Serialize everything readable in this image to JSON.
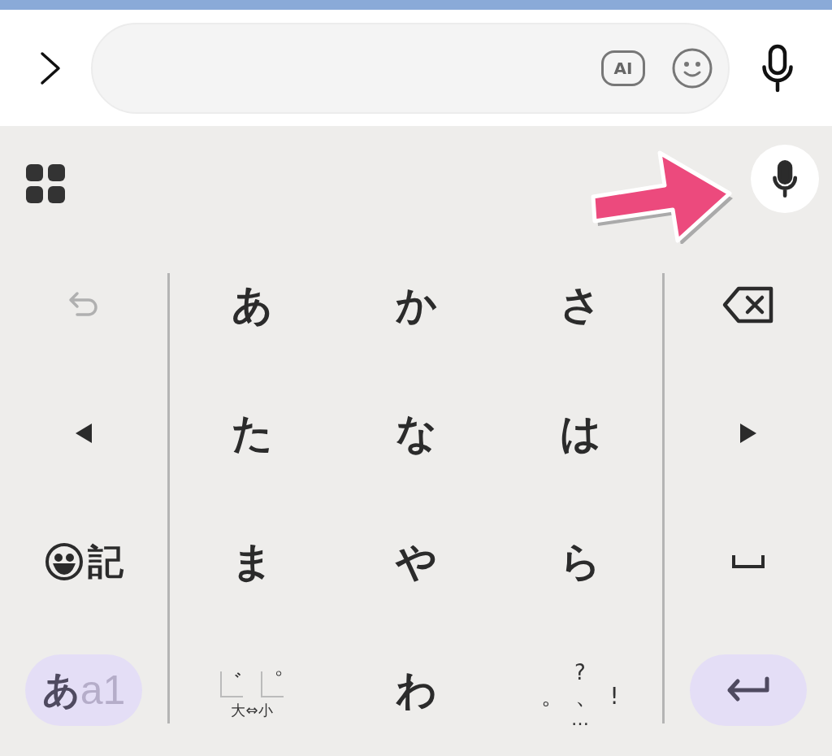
{
  "input_bar": {
    "ai_button": {
      "label": "AI"
    }
  },
  "keyboard": {
    "left_column": {
      "undo": {
        "disabled": true
      },
      "symbol_key": {
        "label": "記"
      },
      "mode_key": {
        "options": [
          {
            "label": "あ",
            "selected": true
          },
          {
            "label": "a1",
            "selected": false
          }
        ]
      }
    },
    "kana_keys": [
      {
        "kind": "kana",
        "label": "あ"
      },
      {
        "kind": "kana",
        "label": "か"
      },
      {
        "kind": "kana",
        "label": "さ"
      },
      {
        "kind": "kana",
        "label": "た"
      },
      {
        "kind": "kana",
        "label": "な"
      },
      {
        "kind": "kana",
        "label": "は"
      },
      {
        "kind": "kana",
        "label": "ま"
      },
      {
        "kind": "kana",
        "label": "や"
      },
      {
        "kind": "kana",
        "label": "ら"
      },
      {
        "kind": "dakuten"
      },
      {
        "kind": "kana",
        "label": "わ"
      },
      {
        "kind": "punctuation"
      }
    ],
    "dakuten_key": {
      "marks": [
        "゛",
        "゜"
      ],
      "caption": "大⇔小"
    },
    "punctuation_key": {
      "top": "?",
      "marks": [
        "。",
        "、",
        "!"
      ],
      "bottom": "…"
    }
  }
}
